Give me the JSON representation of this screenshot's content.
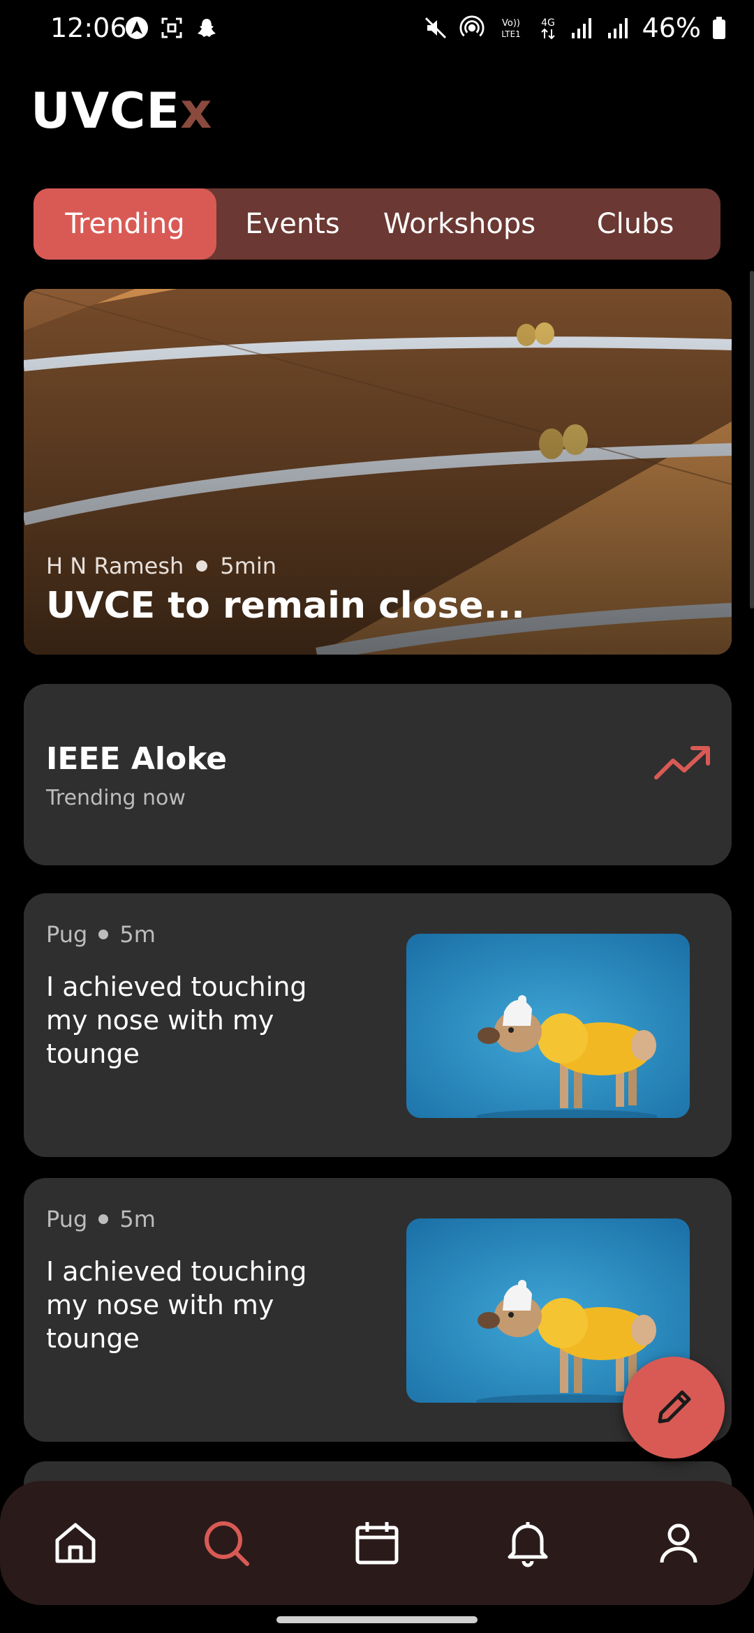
{
  "status_bar": {
    "time": "12:06",
    "battery": "46%",
    "left_icons": [
      "navigation-app-icon",
      "screenshot-icon",
      "snapchat-icon"
    ],
    "right_icons": [
      "mute-icon",
      "hotspot-icon",
      "volte-icon",
      "data-4g-icon",
      "signal-icon",
      "signal-icon",
      "battery-icon"
    ],
    "volte_label": "VoLTE1",
    "data_label": "4G"
  },
  "app": {
    "brand_main": "UVCE",
    "brand_accent": "x",
    "colors": {
      "accent": "#d95a55",
      "tab_bar": "#6b3833",
      "card": "#2f2f2f",
      "nav": "#2a1b1a"
    }
  },
  "tabs": [
    {
      "label": "Trending",
      "active": true
    },
    {
      "label": "Events",
      "active": false
    },
    {
      "label": "Workshops",
      "active": false
    },
    {
      "label": "Clubs",
      "active": false
    }
  ],
  "hero": {
    "author": "H N Ramesh",
    "time": "5min",
    "title": "UVCE to remain close..."
  },
  "trending": {
    "title": "IEEE Aloke",
    "subtitle": "Trending now",
    "icon": "trending-up-icon"
  },
  "posts": [
    {
      "author": "Pug",
      "time": "5m",
      "text": "I achieved touching my nose with my tounge",
      "image": "dog-in-yellow-hoodie"
    },
    {
      "author": "Pug",
      "time": "5m",
      "text": "I achieved touching my nose with my tounge",
      "image": "dog-in-yellow-hoodie"
    }
  ],
  "fab": {
    "icon": "pencil-icon"
  },
  "bottom_nav": [
    {
      "icon": "home-icon",
      "active": false
    },
    {
      "icon": "search-icon",
      "active": true
    },
    {
      "icon": "calendar-icon",
      "active": false
    },
    {
      "icon": "bell-icon",
      "active": false
    },
    {
      "icon": "profile-icon",
      "active": false
    }
  ]
}
